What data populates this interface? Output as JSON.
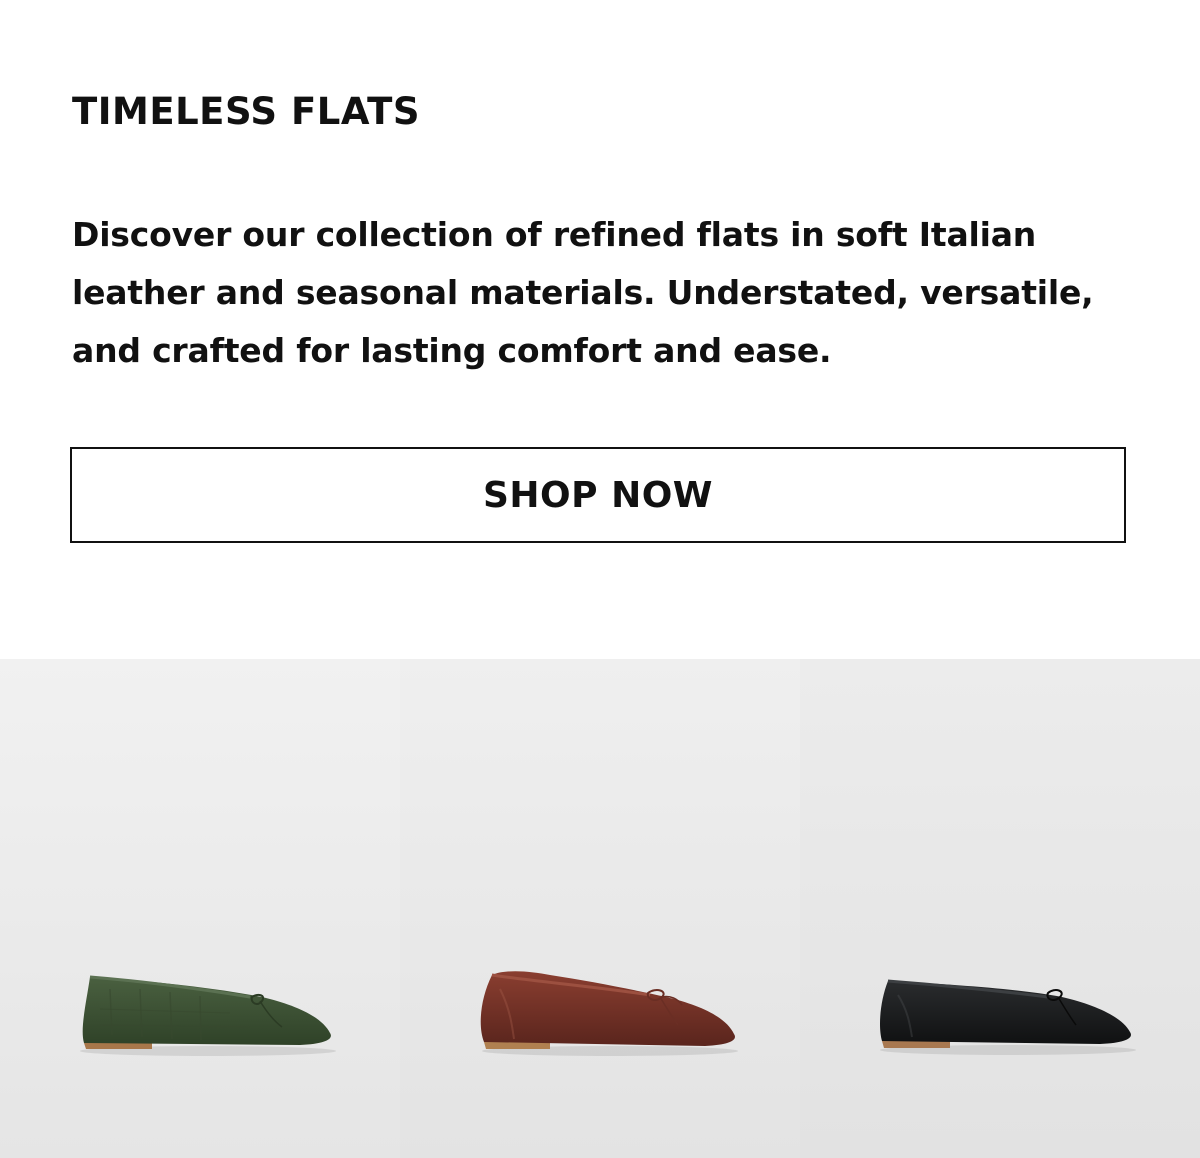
{
  "hero": {
    "title": "TIMELESS FLATS",
    "description": "Discover our collection of refined flats in soft Italian leather and seasonal materials. Understated, versatile, and crafted for lasting comfort and ease.",
    "cta_label": "SHOP NOW"
  },
  "products": [
    {
      "name": "green-suede-ballet-flat",
      "color": "#3e5234",
      "background": "#eeeeee"
    },
    {
      "name": "brown-leather-ballet-flat",
      "color": "#6b2f26",
      "background": "#ececec"
    },
    {
      "name": "black-leather-ballet-flat",
      "color": "#1b1c1d",
      "background": "#e9e9e9"
    }
  ]
}
